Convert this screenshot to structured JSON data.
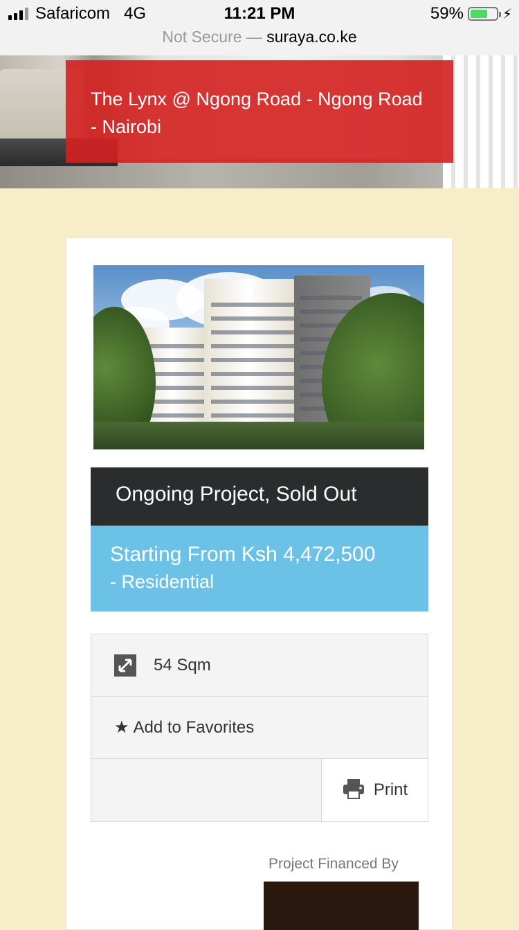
{
  "status_bar": {
    "carrier": "Safaricom",
    "network": "4G",
    "time": "11:21 PM",
    "battery_percent": "59%",
    "battery_level": 0.59
  },
  "address_bar": {
    "security": "Not Secure —",
    "host": "suraya.co.ke"
  },
  "hero": {
    "title": "The Lynx @ Ngong Road - Ngong Road - Nairobi"
  },
  "listing": {
    "status": "Ongoing Project, Sold Out",
    "price_line": "Starting From Ksh 4,472,500",
    "category": "- Residential",
    "area": "54 Sqm",
    "favorites_label": "Add to Favorites",
    "print_label": "Print"
  },
  "financing": {
    "label": "Project Financed By"
  },
  "colors": {
    "banner": "#d42020",
    "status_bg": "#2b2c2e",
    "price_bg": "#6bc1e6",
    "page_bg": "#f7edc9"
  },
  "icons": [
    "signal-icon",
    "battery-icon",
    "charging-icon",
    "resize-arrows-icon",
    "star-icon",
    "printer-icon"
  ]
}
